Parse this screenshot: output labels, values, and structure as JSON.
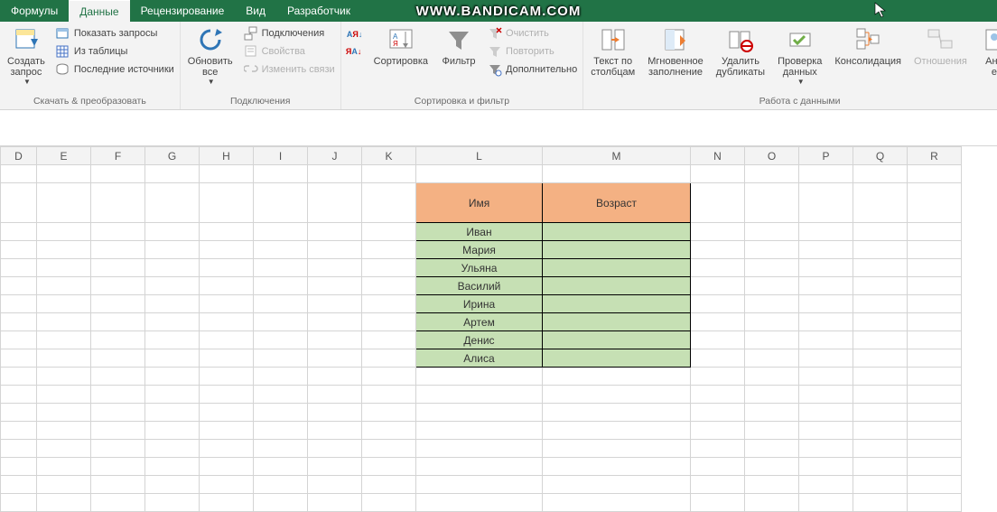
{
  "watermark": "WWW.BANDICAM.COM",
  "tabs": {
    "formulas": "Формулы",
    "data": "Данные",
    "review": "Рецензирование",
    "view": "Вид",
    "developer": "Разработчик"
  },
  "ribbon": {
    "group1": {
      "label": "Скачать & преобразовать",
      "create_query": "Создать\nзапрос",
      "show_queries": "Показать запросы",
      "from_table": "Из таблицы",
      "recent_sources": "Последние источники"
    },
    "group2": {
      "label": "Подключения",
      "refresh_all": "Обновить\nвсе",
      "connections": "Подключения",
      "properties": "Свойства",
      "edit_links": "Изменить связи"
    },
    "group3": {
      "label": "Сортировка и фильтр",
      "sort_az": "А↓Я",
      "sort_za": "Я↓А",
      "sort": "Сортировка",
      "filter": "Фильтр",
      "clear": "Очистить",
      "reapply": "Повторить",
      "advanced": "Дополнительно"
    },
    "group4": {
      "label": "Работа с данными",
      "text_to_cols": "Текст по\nстолбцам",
      "flash_fill": "Мгновенное\nзаполнение",
      "remove_dup": "Удалить\nдубликаты",
      "data_val": "Проверка\nданных",
      "consolidate": "Консолидация",
      "relationships": "Отношения",
      "analysis": "Ана\nе"
    }
  },
  "columns": [
    "D",
    "E",
    "F",
    "G",
    "H",
    "I",
    "J",
    "K",
    "L",
    "M",
    "N",
    "O",
    "P",
    "Q",
    "R"
  ],
  "table": {
    "header_name": "Имя",
    "header_age": "Возраст",
    "rows": [
      "Иван",
      "Мария",
      "Ульяна",
      "Василий",
      "Ирина",
      "Артем",
      "Денис",
      "Алиса"
    ]
  }
}
